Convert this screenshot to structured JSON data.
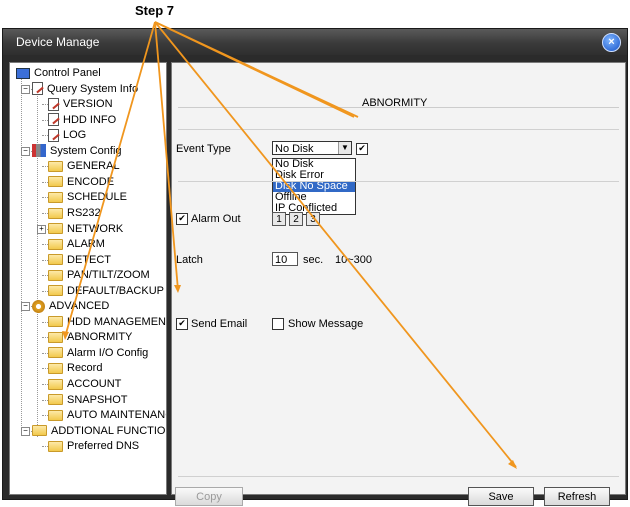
{
  "annotation": {
    "step_label": "Step 7"
  },
  "window": {
    "title": "Device Manage",
    "close_icon_glyph": "×"
  },
  "tree": {
    "items": [
      {
        "label": "Control Panel",
        "icon": "monitor-icon"
      },
      {
        "label": "Query System Info",
        "icon": "document-icon",
        "expander": "−"
      },
      {
        "label": "VERSION",
        "icon": "document-icon"
      },
      {
        "label": "HDD INFO",
        "icon": "document-icon"
      },
      {
        "label": "LOG",
        "icon": "document-icon"
      },
      {
        "label": "System Config",
        "icon": "tools-icon",
        "expander": "−"
      },
      {
        "label": "GENERAL",
        "icon": "folder-icon"
      },
      {
        "label": "ENCODE",
        "icon": "folder-icon"
      },
      {
        "label": "SCHEDULE",
        "icon": "folder-icon"
      },
      {
        "label": "RS232",
        "icon": "folder-icon"
      },
      {
        "label": "NETWORK",
        "icon": "folder-icon",
        "expander": "+"
      },
      {
        "label": "ALARM",
        "icon": "folder-icon"
      },
      {
        "label": "DETECT",
        "icon": "folder-icon"
      },
      {
        "label": "PAN/TILT/ZOOM",
        "icon": "folder-icon"
      },
      {
        "label": "DEFAULT/BACKUP",
        "icon": "folder-icon"
      },
      {
        "label": "ADVANCED",
        "icon": "gear-icon",
        "expander": "−"
      },
      {
        "label": "HDD MANAGEMENT",
        "icon": "folder-icon"
      },
      {
        "label": "ABNORMITY",
        "icon": "folder-icon"
      },
      {
        "label": "Alarm I/O Config",
        "icon": "folder-icon"
      },
      {
        "label": "Record",
        "icon": "folder-icon"
      },
      {
        "label": "ACCOUNT",
        "icon": "folder-icon"
      },
      {
        "label": "SNAPSHOT",
        "icon": "folder-icon"
      },
      {
        "label": "AUTO MAINTENANCI",
        "icon": "folder-icon"
      },
      {
        "label": "ADDTIONAL FUNCTION",
        "icon": "folder-icon",
        "expander": "−"
      },
      {
        "label": "Preferred DNS",
        "icon": "folder-icon"
      }
    ]
  },
  "content": {
    "section_title": "ABNORMITY",
    "event_type": {
      "label": "Event Type",
      "selected": "No Disk",
      "options": [
        "No Disk",
        "Disk Error",
        "Disk No Space",
        "Offline",
        "IP Conflicted"
      ],
      "highlighted": "Disk No Space",
      "enable_checked": true
    },
    "alarm_out": {
      "label": "Alarm Out",
      "checked": true,
      "channels": [
        "1",
        "2",
        "3"
      ]
    },
    "latch": {
      "label": "Latch",
      "value": "10",
      "unit": "sec.",
      "range": "10~300"
    },
    "send_email": {
      "label": "Send Email",
      "checked": true
    },
    "show_message": {
      "label": "Show Message",
      "checked": false
    },
    "buttons": {
      "copy": "Copy",
      "save": "Save",
      "refresh": "Refresh"
    }
  },
  "colors": {
    "annotation_lines": "#f0961e",
    "selection": "#3169c6"
  }
}
